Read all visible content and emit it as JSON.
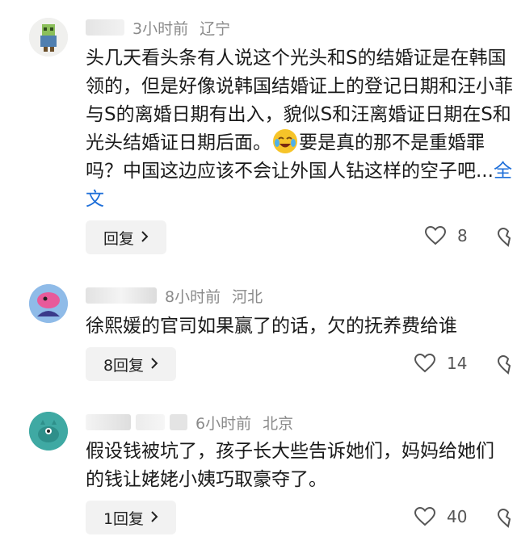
{
  "comments": [
    {
      "time": "3小时前",
      "location": "辽宁",
      "text_part1": "头几天看头条有人说这个光头和S的结婚证是在韩国领的，但是好像说韩国结婚证上的登记日期和汪小菲与S的离婚日期有出入，貌似S和汪离婚证日期在S和光头结婚证日期后面。",
      "text_part2": "要是真的那不是重婚罪吗？中国这边应该不会让外国人钻这样的空子吧...",
      "more": "全文",
      "reply_label": "回复",
      "likes": "8"
    },
    {
      "time": "8小时前",
      "location": "河北",
      "text": "徐熙媛的官司如果赢了的话，欠的抚养费给谁",
      "reply_label": "8回复",
      "likes": "14"
    },
    {
      "time": "6小时前",
      "location": "北京",
      "text": "假设钱被坑了，孩子长大些告诉她们，妈妈给她们的钱让姥姥小姨巧取豪夺了。",
      "reply_label": "1回复",
      "likes": "40"
    }
  ],
  "icons": {
    "like": "heart-icon",
    "dislike": "broken-heart-icon",
    "chevron": "chevron-right-icon",
    "emoji": "laughing-crying-emoji-icon"
  },
  "colors": {
    "meta": "#8a8a8a",
    "link": "#1e6fd9",
    "reply_bg": "#f2f2f2"
  }
}
